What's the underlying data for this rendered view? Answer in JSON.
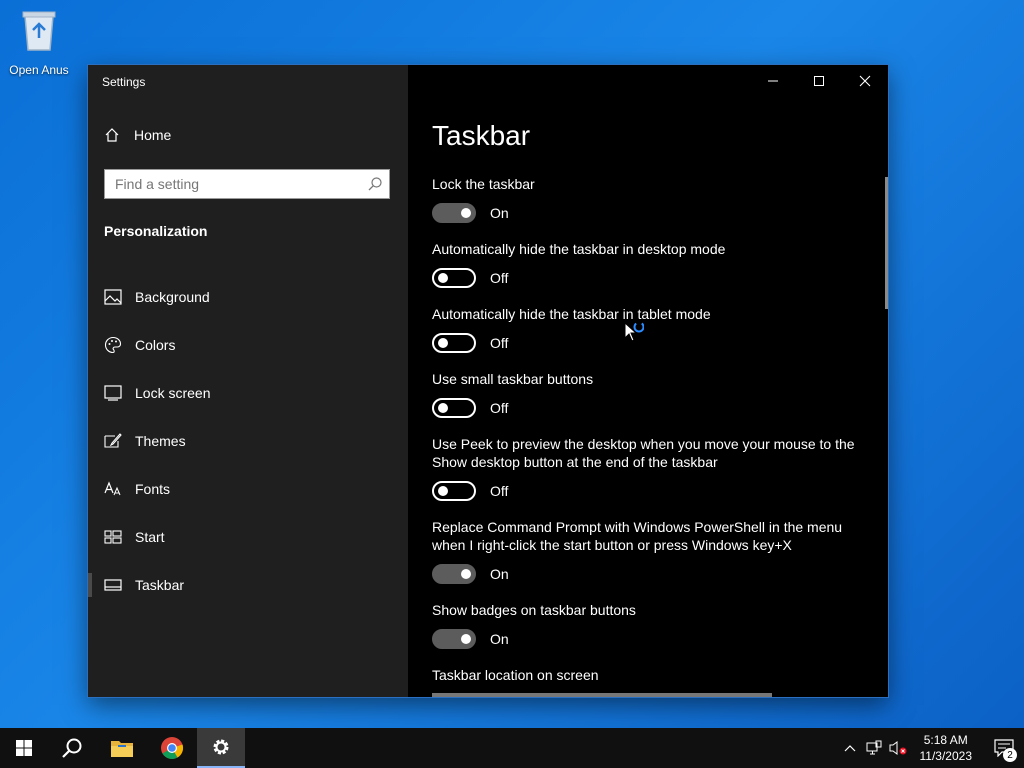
{
  "desktop": {
    "recycle_bin_label": "Open Anus"
  },
  "window": {
    "title": "Settings",
    "sidebar": {
      "home_label": "Home",
      "search_placeholder": "Find a setting",
      "section_title": "Personalization",
      "items": [
        {
          "label": "Background",
          "icon": "image-icon"
        },
        {
          "label": "Colors",
          "icon": "palette-icon"
        },
        {
          "label": "Lock screen",
          "icon": "lock-screen-icon"
        },
        {
          "label": "Themes",
          "icon": "brush-icon"
        },
        {
          "label": "Fonts",
          "icon": "font-icon"
        },
        {
          "label": "Start",
          "icon": "start-layout-icon"
        },
        {
          "label": "Taskbar",
          "icon": "taskbar-icon"
        }
      ]
    },
    "content": {
      "title": "Taskbar",
      "settings": [
        {
          "label": "Lock the taskbar",
          "state": "On"
        },
        {
          "label": "Automatically hide the taskbar in desktop mode",
          "state": "Off"
        },
        {
          "label": "Automatically hide the taskbar in tablet mode",
          "state": "Off"
        },
        {
          "label": "Use small taskbar buttons",
          "state": "Off"
        },
        {
          "label": "Use Peek to preview the desktop when you move your mouse to the Show desktop button at the end of the taskbar",
          "state": "Off"
        },
        {
          "label": "Replace Command Prompt with Windows PowerShell in the menu when I right-click the start button or press Windows key+X",
          "state": "On"
        },
        {
          "label": "Show badges on taskbar buttons",
          "state": "On"
        }
      ],
      "location_label": "Taskbar location on screen"
    }
  },
  "taskbar": {
    "clock_time": "5:18 AM",
    "clock_date": "11/3/2023",
    "notification_count": "2"
  },
  "colors": {
    "accent": "#0078d7",
    "toggle_on": "#5c5c5c",
    "sidebar_bg": "#1f1f1f"
  }
}
